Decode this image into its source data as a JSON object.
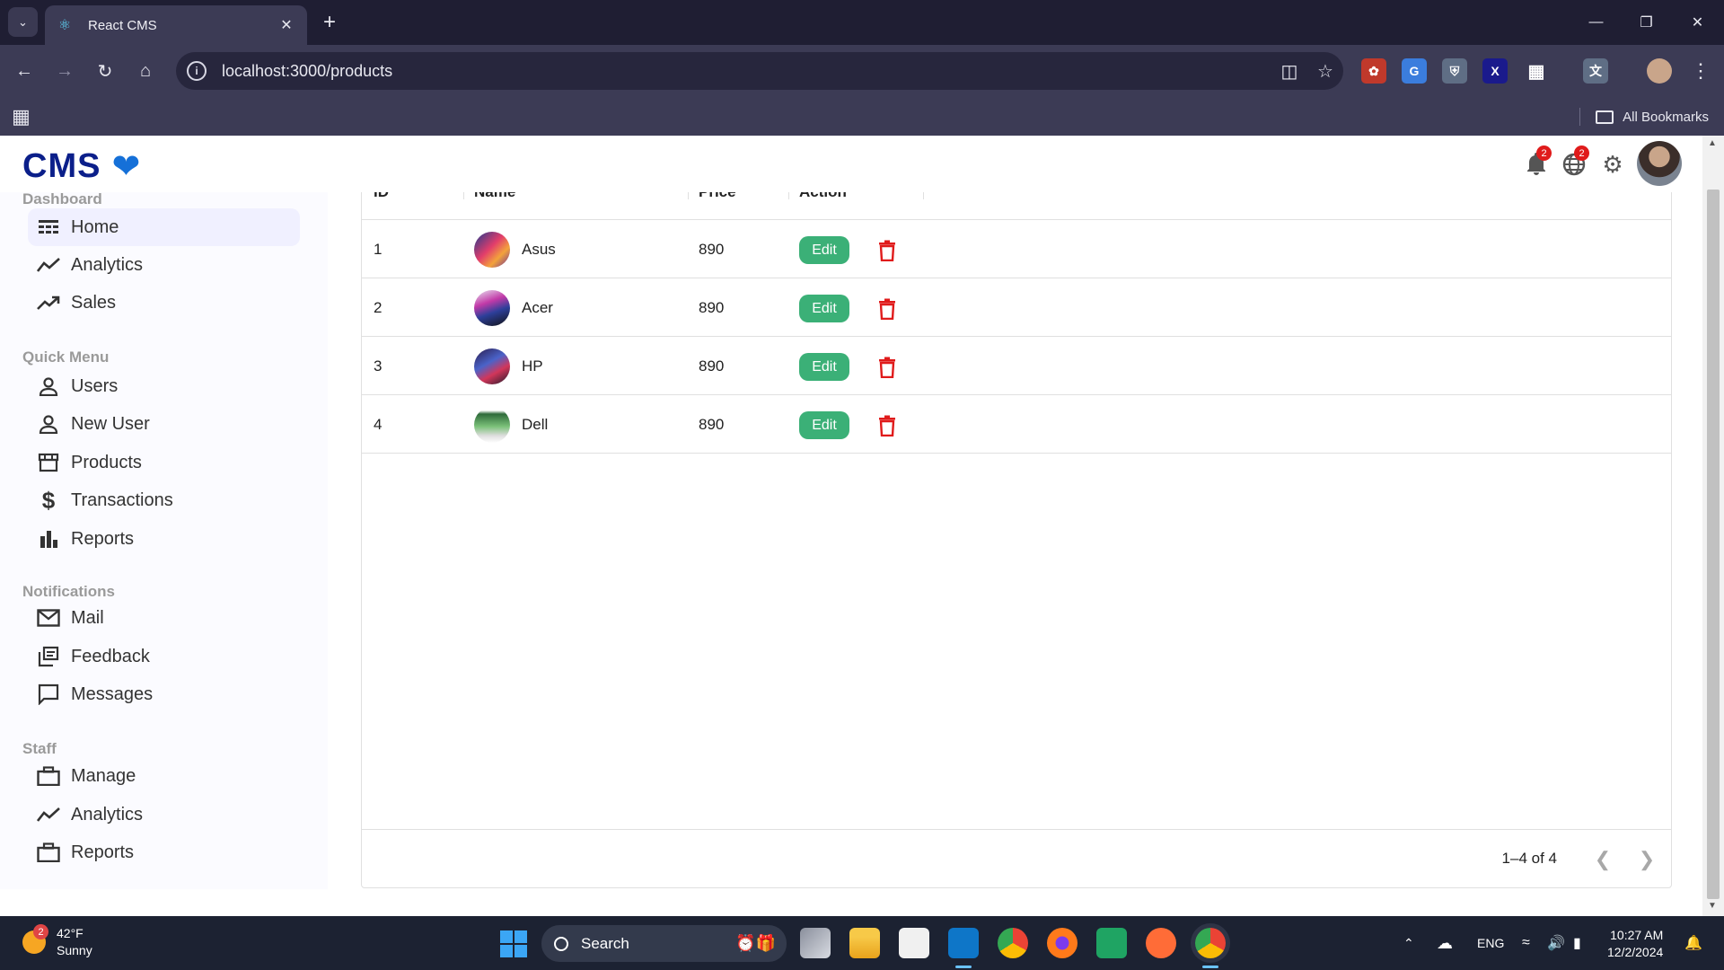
{
  "browser": {
    "tab_title": "React CMS",
    "url": "localhost:3000/products",
    "all_bookmarks": "All Bookmarks"
  },
  "app": {
    "logo_text": "CMS",
    "notifications_badge": "2",
    "language_badge": "2"
  },
  "sidebar": {
    "sections": [
      {
        "title": "Dashboard",
        "items": [
          {
            "label": "Home",
            "icon": "home-icon",
            "active": true
          },
          {
            "label": "Analytics",
            "icon": "timeline-icon"
          },
          {
            "label": "Sales",
            "icon": "trending-up-icon"
          }
        ]
      },
      {
        "title": "Quick Menu",
        "items": [
          {
            "label": "Users",
            "icon": "person-icon"
          },
          {
            "label": "New User",
            "icon": "person-add-icon"
          },
          {
            "label": "Products",
            "icon": "storefront-icon"
          },
          {
            "label": "Transactions",
            "icon": "dollar-icon"
          },
          {
            "label": "Reports",
            "icon": "bar-chart-icon"
          }
        ]
      },
      {
        "title": "Notifications",
        "items": [
          {
            "label": "Mail",
            "icon": "mail-icon"
          },
          {
            "label": "Feedback",
            "icon": "feedback-icon"
          },
          {
            "label": "Messages",
            "icon": "chat-icon"
          }
        ]
      },
      {
        "title": "Staff",
        "items": [
          {
            "label": "Manage",
            "icon": "briefcase-icon"
          },
          {
            "label": "Analytics",
            "icon": "timeline-icon"
          },
          {
            "label": "Reports",
            "icon": "briefcase-icon"
          }
        ]
      }
    ]
  },
  "table": {
    "columns": [
      "ID",
      "Name",
      "Price",
      "Action"
    ],
    "rows": [
      {
        "id": "1",
        "name": "Asus",
        "price": "890"
      },
      {
        "id": "2",
        "name": "Acer",
        "price": "890"
      },
      {
        "id": "3",
        "name": "HP",
        "price": "890"
      },
      {
        "id": "4",
        "name": "Dell",
        "price": "890"
      }
    ],
    "edit_label": "Edit",
    "pagination": "1–4 of 4"
  },
  "taskbar": {
    "weather_temp": "42°F",
    "weather_desc": "Sunny",
    "weather_badge": "2",
    "search_label": "Search",
    "lang": "ENG",
    "time": "10:27 AM",
    "date": "12/2/2024"
  },
  "colors": {
    "edit_button": "#3bb077",
    "delete_icon": "#e01b1b",
    "logo": "#0b1f8a",
    "browser_frame": "#3c3b55"
  }
}
